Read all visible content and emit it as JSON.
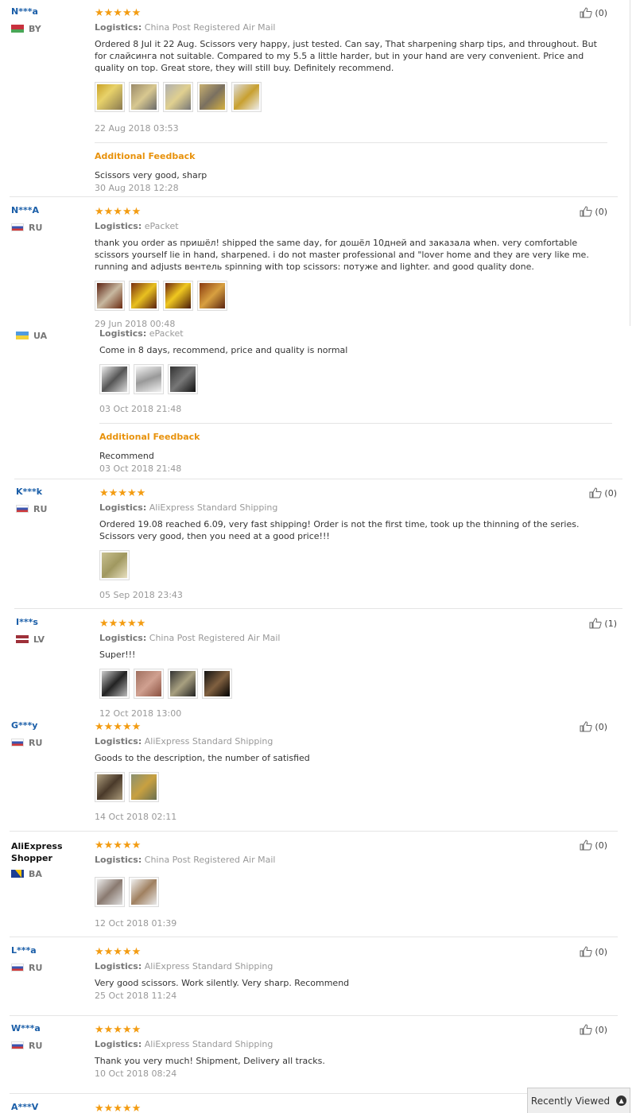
{
  "reviews": [
    {
      "user": "N***a",
      "country": "BY",
      "stars": "★★★★★",
      "logistics_label": "Logistics:",
      "logistics": "China Post Registered Air Mail",
      "text": "Ordered 8 Jul it 22 Aug. Scissors very happy, just tested. Can say, That sharpening sharp tips, and throughout. But for слайсинга not suitable. Compared to my 5.5 a little harder, but in your hand are very convenient. Price and quality on top. Great store, they will still buy. Definitely recommend.",
      "date": "22 Aug 2018 03:53",
      "helpful": "(0)",
      "additional_title": "Additional Feedback",
      "additional_text": "Scissors very good, sharp",
      "additional_date": "30 Aug 2018 12:28"
    },
    {
      "user": "N***A",
      "country": "RU",
      "stars": "★★★★★",
      "logistics_label": "Logistics:",
      "logistics": "ePacket",
      "text": "thank you order as пришёл! shipped the same day, for дошёл 10дней and заказала when. very comfortable scissors yourself lie in hand, sharpened. i do not master professional and \"lover home and they are very like me. running and adjusts вентель spinning with top scissors: потуже and lighter. and good quality done.",
      "date": "29 Jun 2018 00:48",
      "helpful": "(0)"
    },
    {
      "user": "",
      "country": "UA",
      "logistics_label": "Logistics:",
      "logistics": "ePacket",
      "text": "Come in 8 days, recommend, price and quality is normal",
      "date": "03 Oct 2018 21:48",
      "additional_title": "Additional Feedback",
      "additional_text": "Recommend",
      "additional_date": "03 Oct 2018 21:48"
    },
    {
      "user": "K***k",
      "country": "RU",
      "stars": "★★★★★",
      "logistics_label": "Logistics:",
      "logistics": "AliExpress Standard Shipping",
      "text": "Ordered 19.08 reached 6.09, very fast shipping! Order is not the first time, took up the thinning of the series. Scissors very good, then you need at a good price!!!",
      "date": "05 Sep 2018 23:43",
      "helpful": "(0)"
    },
    {
      "user": "I***s",
      "country": "LV",
      "stars": "★★★★★",
      "logistics_label": "Logistics:",
      "logistics": "China Post Registered Air Mail",
      "text": "Super!!!",
      "date": "12 Oct 2018 13:00",
      "helpful": "(1)"
    },
    {
      "user": "G***y",
      "country": "RU",
      "stars": "★★★★★",
      "logistics_label": "Logistics:",
      "logistics": "AliExpress Standard Shipping",
      "text": "Goods to the description, the number of satisfied",
      "date": "14 Oct 2018 02:11",
      "helpful": "(0)"
    },
    {
      "user": "AliExpress Shopper",
      "country": "BA",
      "stars": "★★★★★",
      "logistics_label": "Logistics:",
      "logistics": "China Post Registered Air Mail",
      "date": "12 Oct 2018 01:39",
      "helpful": "(0)"
    },
    {
      "user": "L***a",
      "country": "RU",
      "stars": "★★★★★",
      "logistics_label": "Logistics:",
      "logistics": "AliExpress Standard Shipping",
      "text": "Very good scissors. Work silently. Very sharp. Recommend",
      "date": "25 Oct 2018 11:24",
      "helpful": "(0)"
    },
    {
      "user": "W***a",
      "country": "RU",
      "stars": "★★★★★",
      "logistics_label": "Logistics:",
      "logistics": "AliExpress Standard Shipping",
      "text": "Thank you very much! Shipment, Delivery all tracks.",
      "date": "10 Oct 2018 08:24",
      "helpful": "(0)"
    },
    {
      "user": "A***V",
      "stars": "★★★★★"
    }
  ],
  "recently_viewed": {
    "label": "Recently Viewed"
  },
  "colors": {
    "star": "#f39c12",
    "username": "#1a5ea8",
    "additional": "#e8920c"
  }
}
